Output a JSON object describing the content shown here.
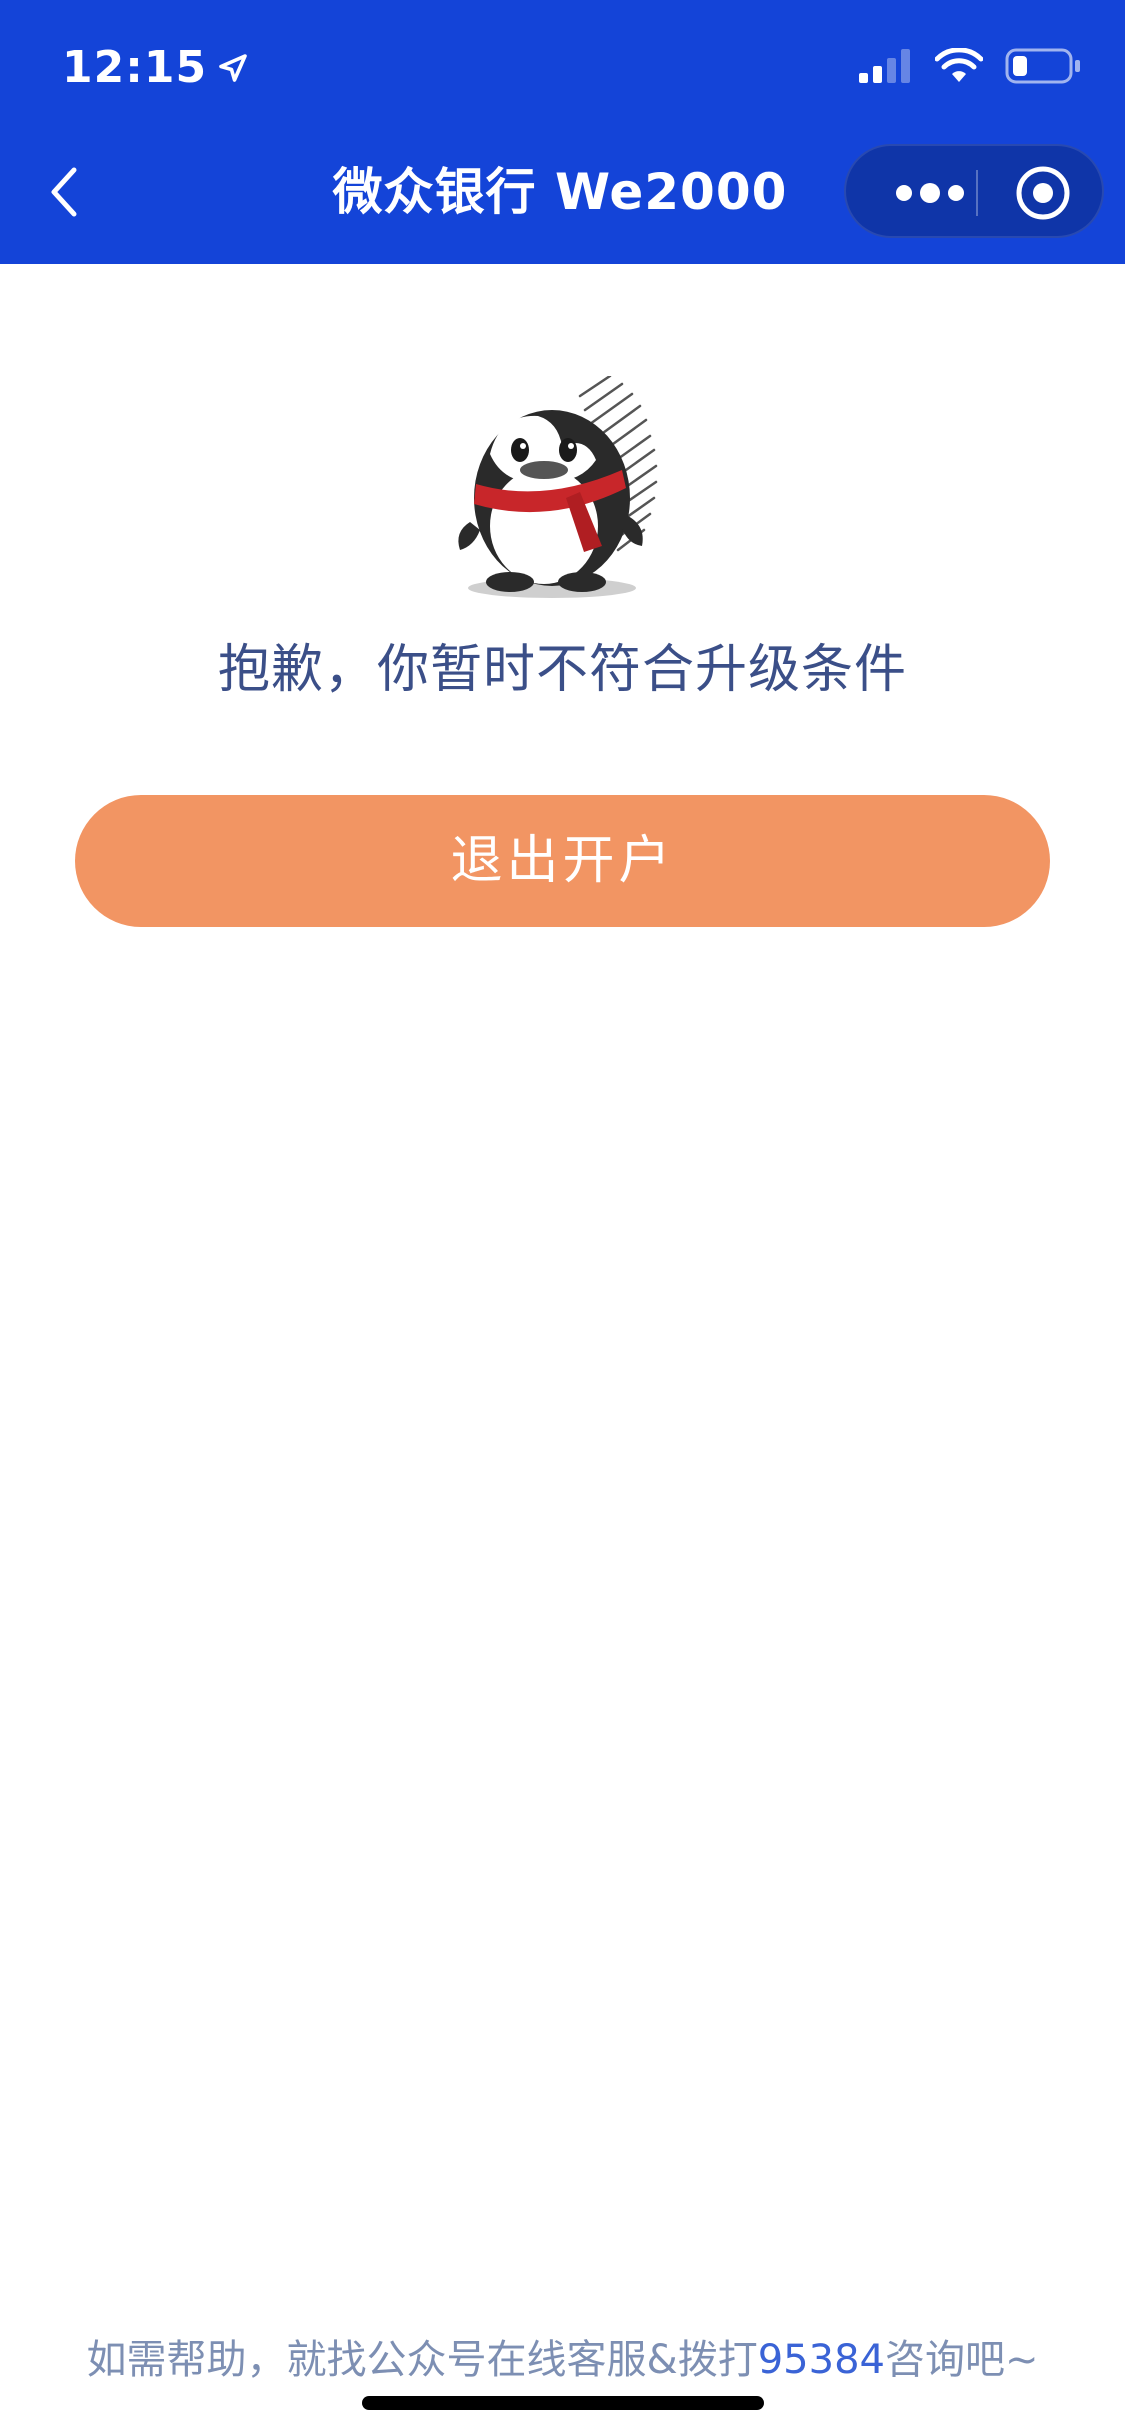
{
  "status_bar": {
    "time": "12:15",
    "location_icon": "location-arrow-icon",
    "signal_icon": "cellular-signal-icon",
    "wifi_icon": "wifi-icon",
    "battery_icon": "battery-icon"
  },
  "nav": {
    "back_icon": "chevron-left-icon",
    "title": "微众银行 We2000",
    "more_icon": "more-dots-icon",
    "close_icon": "target-circle-icon"
  },
  "main": {
    "mascot_icon": "penguin-mascot-icon",
    "error_message": "抱歉，你暂时不符合升级条件",
    "exit_button_label": "退出开户",
    "exit_button_color": "#f29563"
  },
  "footer": {
    "help_prefix": "如需帮助，就找公众号在线客服&拨打",
    "help_phone": "95384",
    "help_suffix": "咨询吧~"
  },
  "colors": {
    "header_bg": "#1444d8",
    "message_text": "#3b4f88",
    "footer_text": "#7d8fb3",
    "phone_link": "#3a63d6"
  }
}
